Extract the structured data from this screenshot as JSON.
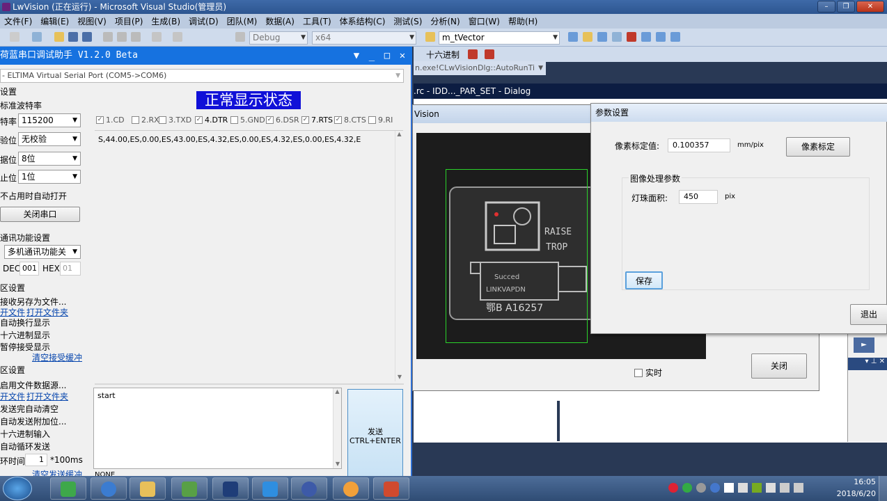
{
  "vs": {
    "title": "LwVision (正在运行) - Microsoft Visual Studio(管理员)",
    "menu": [
      "文件(F)",
      "编辑(E)",
      "视图(V)",
      "项目(P)",
      "生成(B)",
      "调试(D)",
      "团队(M)",
      "数据(A)",
      "工具(T)",
      "体系结构(C)",
      "测试(S)",
      "分析(N)",
      "窗口(W)",
      "帮助(H)"
    ],
    "config": "Debug",
    "platform": "x64",
    "find_combo": "m_tVector",
    "hex_label": "十六进制",
    "callstack": "n.exe!CLwVisionDlg::AutoRunTi",
    "doc_tab": ".rc - IDD..._PAR_SET - Dialog"
  },
  "serial": {
    "title": "荷蓝串口调试助手 V1.2.0 Beta",
    "port": "- ELTIMA Virtual Serial Port (COM5->COM6)",
    "section_port": "设置",
    "baud_label_full": "标准波特率",
    "baud_label": "特率",
    "baud": "115200",
    "check_label": "验位",
    "check": "无校验",
    "data_label": "据位",
    "data": "8位",
    "stop_label": "止位",
    "stop": "1位",
    "auto_open": "不占用时自动打开",
    "close_btn": "关闭串口",
    "section_comm": "通讯功能设置",
    "multi": "多机通讯功能关",
    "dec_label": "DEC",
    "dec": "001",
    "hex_label": "HEX",
    "hex": "01",
    "section_recv": "区设置",
    "recv_save": "接收另存为文件...",
    "link_file": "开文件",
    "link_folder": "打开文件夹",
    "auto_newline": "自动换行显示",
    "hex_show": "十六进制显示",
    "pause_recv": "暂停接受显示",
    "clear_recv": "清空接受缓冲",
    "section_send": "区设置",
    "use_file": "启用文件数据源...",
    "link_file2": "开文件",
    "link_folder2": "打开文件夹",
    "send_clear": "发送完自动清空",
    "send_append": "自动发送附加位...",
    "hex_input": "十六进制输入",
    "auto_loop": "自动循环发送",
    "loop_label": "环时间",
    "loop_value": "1",
    "loop_unit": "*100ms",
    "clear_send": "清空发送缓冲",
    "status": "NONE",
    "state_label": "正常显示状态",
    "signals": [
      {
        "label": "1.CD",
        "checked": true,
        "active": false
      },
      {
        "label": "2.RXD",
        "checked": false,
        "active": false
      },
      {
        "label": "3.TXD",
        "checked": false,
        "active": false
      },
      {
        "label": "4.DTR",
        "checked": true,
        "active": true
      },
      {
        "label": "5.GND",
        "checked": false,
        "active": false
      },
      {
        "label": "6.DSR",
        "checked": true,
        "active": false
      },
      {
        "label": "7.RTS",
        "checked": true,
        "active": true
      },
      {
        "label": "8.CTS",
        "checked": true,
        "active": false
      },
      {
        "label": "9.RI",
        "checked": false,
        "active": false
      }
    ],
    "received": "S,44.00,ES,0.00,ES,43.00,ES,4.32,ES,0.00,ES,4.32,ES,0.00,ES,4.32,E",
    "send_text": "start",
    "send_btn_1": "发送",
    "send_btn_2": "CTRL+ENTER"
  },
  "lwvision": {
    "title": "Vision",
    "realtime": "实时",
    "close_btn": "关闭",
    "card_text_1": "TROP",
    "card_text_2": "RAISE",
    "card_text_3": "Succed",
    "card_text_4": "LINKVAPDN",
    "card_text_5": "鄂B A16257"
  },
  "param_dialog": {
    "title": "参数设置",
    "calib_label": "像素标定值:",
    "calib_value": "0.100357",
    "calib_unit": "mm/pix",
    "calib_btn": "像素标定",
    "group_label": "图像处理参数",
    "area_label": "灯珠面积:",
    "area_value": "450",
    "area_unit": "pix",
    "save_btn": "保存",
    "exit_btn": "退出"
  },
  "taskbar": {
    "time": "16:05",
    "date": "2018/6/20",
    "apps": [
      "ie-icon",
      "qq-icon",
      "folder-icon",
      "app-icon",
      "vs-icon",
      "wps-icon",
      "loop-icon",
      "ha-icon",
      "office-icon"
    ]
  }
}
